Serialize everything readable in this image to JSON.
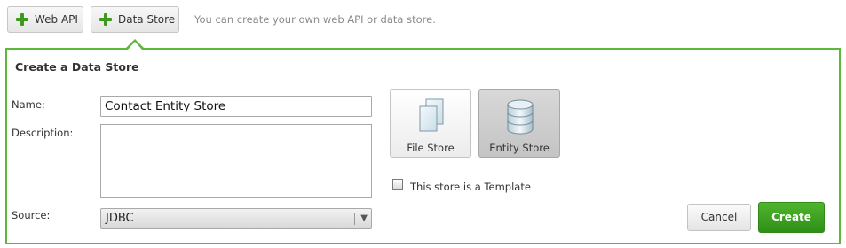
{
  "toolbar": {
    "web_api_label": "Web API",
    "data_store_label": "Data Store",
    "hint": "You can create your own web API or data store."
  },
  "form": {
    "title": "Create a Data Store",
    "name_label": "Name:",
    "name_value": "Contact Entity Store",
    "description_label": "Description:",
    "description_value": "",
    "source_label": "Source:",
    "source_value": "JDBC"
  },
  "store_types": [
    {
      "label": "File Store",
      "icon": "file-store-icon",
      "selected": false
    },
    {
      "label": "Entity Store",
      "icon": "entity-store-icon",
      "selected": true
    }
  ],
  "template": {
    "label": "This store is a Template",
    "checked": false
  },
  "actions": {
    "cancel_label": "Cancel",
    "create_label": "Create"
  },
  "colors": {
    "accent_green": "#5cb83a",
    "create_button": "#3a9f1f",
    "plus_icon": "#3e9a1f"
  }
}
